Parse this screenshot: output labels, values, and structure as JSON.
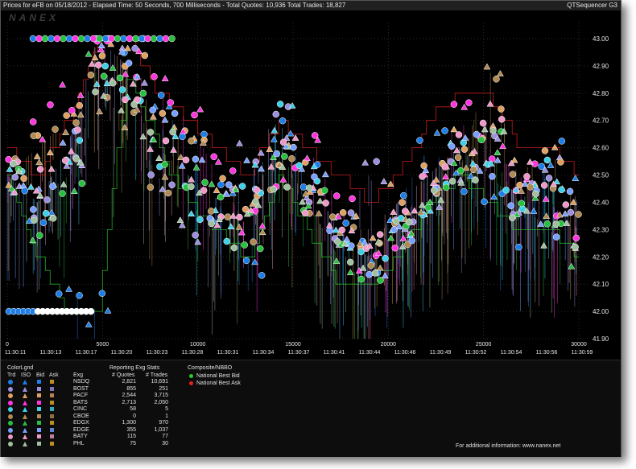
{
  "window": {
    "title": "Prices for  eFB  on  05/18/2012  -  Elapsed Time: 50 Seconds, 700 Milliseconds  -  Total Quotes: 10,936  Total Trades: 18,827",
    "app_name": "QTSequencer G3",
    "logo": "NANEX"
  },
  "chart_data": {
    "type": "scatter",
    "title": "",
    "xlabel": "",
    "ylabel": "",
    "ylim": [
      41.9,
      43.05
    ],
    "y_ticks": [
      "43.00",
      "42.90",
      "42.80",
      "42.70",
      "42.60",
      "42.50",
      "42.40",
      "42.30",
      "42.20",
      "42.10",
      "42.00",
      "41.90"
    ],
    "x_count_ticks": [
      "0",
      "5000",
      "10000",
      "15000",
      "20000",
      "25000",
      "30000"
    ],
    "x_time_ticks": [
      "11:30:11",
      "11:30:13",
      "11:30:17",
      "11:30:20",
      "11:30:23",
      "11:30:28",
      "11:30:31",
      "11:30:34",
      "11:30:37",
      "11:30:41",
      "11:30:44",
      "11:30:46",
      "11:30:49",
      "11:30:52",
      "11:30:54",
      "11:30:56",
      "11:30:59"
    ],
    "series": [
      {
        "name": "NSDQ",
        "color": "#1e7ee8",
        "values": [
          42.5,
          42.3,
          42.1,
          42.0,
          43.0,
          42.8,
          42.6,
          42.4,
          42.2,
          42.7,
          42.5,
          42.3,
          42.2,
          42.4,
          42.6,
          42.5,
          42.4,
          42.3,
          42.6,
          42.5
        ]
      },
      {
        "name": "BOST",
        "color": "#9c8fe0",
        "values": [
          42.5,
          42.4,
          42.6,
          43.0,
          42.9,
          42.5,
          42.3,
          42.4,
          42.6,
          42.7,
          42.4,
          42.3,
          42.5,
          42.3,
          42.4,
          42.5,
          42.6,
          42.4,
          42.5,
          42.4
        ]
      },
      {
        "name": "PACF",
        "color": "#e0a060",
        "values": [
          42.5,
          42.6,
          42.7,
          43.0,
          42.9,
          42.7,
          42.6,
          42.5,
          42.4,
          42.6,
          42.5,
          42.3,
          42.2,
          42.4,
          42.5,
          42.6,
          42.7,
          42.5,
          42.6,
          42.4
        ]
      },
      {
        "name": "BATS",
        "color": "#ff36e0",
        "values": [
          42.5,
          42.7,
          42.8,
          43.0,
          42.9,
          42.8,
          42.7,
          42.5,
          42.3,
          42.5,
          42.6,
          42.4,
          42.2,
          42.3,
          42.5,
          42.7,
          42.6,
          42.5,
          42.4,
          42.3
        ]
      },
      {
        "name": "CINC",
        "color": "#3fd0e8",
        "values": [
          42.5,
          42.4,
          42.6,
          42.9,
          42.8,
          42.6,
          42.4,
          42.3,
          42.5,
          42.7,
          42.5,
          42.3,
          42.2,
          42.3,
          42.4,
          42.6,
          42.5,
          42.4,
          42.5,
          42.3
        ]
      },
      {
        "name": "CBOE",
        "color": "#b08a50",
        "values": [
          42.5,
          42.6,
          42.7,
          42.8,
          42.7,
          42.5,
          42.6,
          42.4,
          42.3,
          42.5,
          42.4,
          42.3,
          42.2,
          42.3,
          42.4,
          42.5,
          42.9,
          42.5,
          42.4,
          42.3
        ]
      },
      {
        "name": "EDGX",
        "color": "#28c040",
        "values": [
          42.5,
          42.3,
          42.5,
          42.9,
          42.8,
          42.6,
          42.5,
          42.4,
          42.3,
          42.6,
          42.4,
          42.2,
          42.1,
          42.3,
          42.4,
          42.5,
          42.6,
          42.4,
          42.3,
          42.2
        ]
      },
      {
        "name": "EDGE",
        "color": "#78a0ff",
        "values": [
          42.5,
          42.4,
          42.6,
          43.0,
          42.9,
          42.7,
          42.5,
          42.4,
          42.5,
          42.6,
          42.5,
          42.3,
          42.2,
          42.3,
          42.5,
          42.6,
          42.5,
          42.4,
          42.3,
          42.4
        ]
      },
      {
        "name": "BATY",
        "color": "#f098c8",
        "values": [
          42.5,
          42.5,
          42.6,
          42.9,
          42.8,
          42.6,
          42.5,
          42.3,
          42.4,
          42.6,
          42.4,
          42.3,
          42.3,
          42.4,
          42.5,
          42.6,
          42.7,
          42.5,
          42.4,
          42.3
        ]
      },
      {
        "name": "PHL",
        "color": "#a0c0a0",
        "values": [
          42.5,
          42.4,
          42.5,
          42.8,
          42.7,
          42.6,
          42.4,
          42.3,
          42.4,
          42.5,
          42.4,
          42.2,
          42.2,
          42.3,
          42.4,
          42.5,
          42.6,
          42.4,
          42.3,
          42.2
        ]
      }
    ],
    "nbbo": {
      "bid_color": "#28c828",
      "ask_color": "#e82020",
      "bid": [
        42.5,
        42.2,
        42.0,
        42.0,
        42.9,
        42.6,
        42.4,
        42.3,
        42.2,
        42.5,
        42.3,
        42.1,
        42.1,
        42.2,
        42.4,
        42.5,
        42.4,
        42.3,
        42.3,
        42.2
      ],
      "ask": [
        42.6,
        42.5,
        42.7,
        43.0,
        43.0,
        42.8,
        42.7,
        42.6,
        42.5,
        42.7,
        42.6,
        42.5,
        42.4,
        42.5,
        42.7,
        42.8,
        42.8,
        42.6,
        42.6,
        42.5
      ]
    },
    "grid": true,
    "legend": "bottom-panel"
  },
  "legend_panel": {
    "headers": {
      "colorlgnd": "ColorLgnd",
      "trd": "Trd",
      "iso": "ISO",
      "bid": "Bid",
      "ask": "Ask",
      "exg": "Exg",
      "stats_title": "Reporting Exg Stats",
      "quotes": "# Quotes",
      "trades": "# Trades",
      "composite": "Composite/NBBO"
    },
    "rows": [
      {
        "exg": "NSDQ",
        "quotes": "2,821",
        "trades": "10,691",
        "color": "#1e7ee8"
      },
      {
        "exg": "BOST",
        "quotes": "855",
        "trades": "251",
        "color": "#9c8fe0"
      },
      {
        "exg": "PACF",
        "quotes": "2,544",
        "trades": "3,715",
        "color": "#e0a060"
      },
      {
        "exg": "BATS",
        "quotes": "2,713",
        "trades": "2,050",
        "color": "#ff36e0"
      },
      {
        "exg": "CINC",
        "quotes": "58",
        "trades": "5",
        "color": "#3fd0e8"
      },
      {
        "exg": "CBOE",
        "quotes": "0",
        "trades": "1",
        "color": "#b08a50"
      },
      {
        "exg": "EDGX",
        "quotes": "1,300",
        "trades": "970",
        "color": "#28c040"
      },
      {
        "exg": "EDGE",
        "quotes": "355",
        "trades": "1,037",
        "color": "#78a0ff"
      },
      {
        "exg": "BATY",
        "quotes": "115",
        "trades": "77",
        "color": "#f098c8"
      },
      {
        "exg": "PHL",
        "quotes": "75",
        "trades": "30",
        "color": "#a0c0a0"
      }
    ],
    "composite": [
      {
        "label": "National Best Bid",
        "color": "#28c828"
      },
      {
        "label": "National Best Ask",
        "color": "#e82020"
      }
    ],
    "footer": "For additional information: www.nanex.net"
  }
}
